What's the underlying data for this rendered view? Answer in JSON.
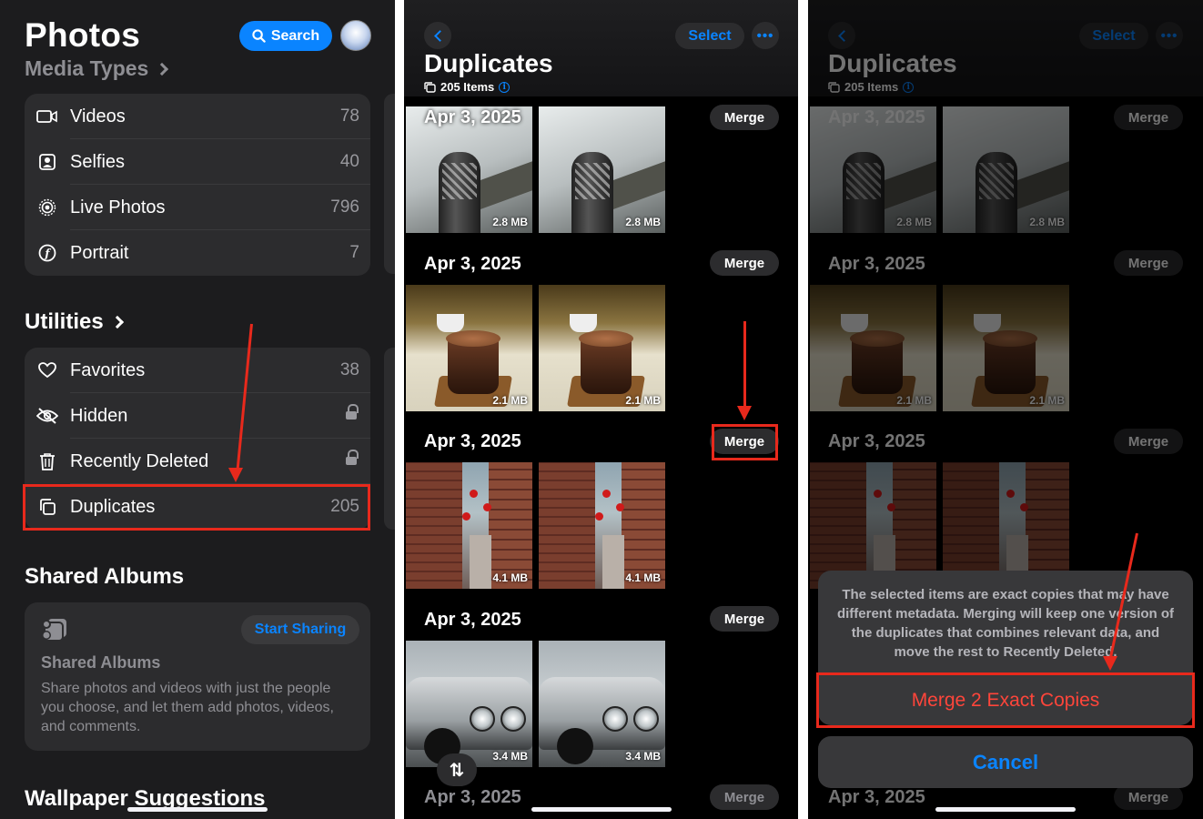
{
  "panel1": {
    "title": "Photos",
    "search_label": "Search",
    "media_types_label": "Media Types",
    "media_items": [
      {
        "label": "Videos",
        "count": "78"
      },
      {
        "label": "Selfies",
        "count": "40"
      },
      {
        "label": "Live Photos",
        "count": "796"
      },
      {
        "label": "Portrait",
        "count": "7"
      }
    ],
    "utilities_label": "Utilities",
    "utility_items": [
      {
        "label": "Favorites",
        "count": "38"
      },
      {
        "label": "Hidden",
        "count": ""
      },
      {
        "label": "Recently Deleted",
        "count": ""
      },
      {
        "label": "Duplicates",
        "count": "205"
      }
    ],
    "shared_albums_heading": "Shared Albums",
    "start_sharing_label": "Start Sharing",
    "shared_card_title": "Shared Albums",
    "shared_card_desc": "Share photos and videos with just the people you choose, and let them add photos, videos, and comments.",
    "wallpaper_heading": "Wallpaper Suggestions"
  },
  "duplicates": {
    "title": "Duplicates",
    "items_count": "205 Items",
    "select_label": "Select",
    "more_label": "•••",
    "merge_label": "Merge",
    "groups": [
      {
        "date": "Apr 3, 2025",
        "size": "2.8 MB"
      },
      {
        "date": "Apr 3, 2025",
        "size": "2.1 MB"
      },
      {
        "date": "Apr 3, 2025",
        "size": "4.1 MB"
      },
      {
        "date": "Apr 3, 2025",
        "size": "3.4 MB"
      },
      {
        "date": "Apr 3, 2025",
        "size": ""
      }
    ],
    "sort_icon_glyph": "⇅"
  },
  "sheet": {
    "message": "The selected items are exact copies that may have different metadata. Merging will keep one version of the duplicates that combines relevant data, and move the rest to Recently Deleted.",
    "merge_action": "Merge 2 Exact Copies",
    "cancel_label": "Cancel"
  },
  "colors": {
    "accent_blue": "#0a84ff",
    "highlight_red": "#e8291c",
    "destructive_red": "#ff453a"
  }
}
